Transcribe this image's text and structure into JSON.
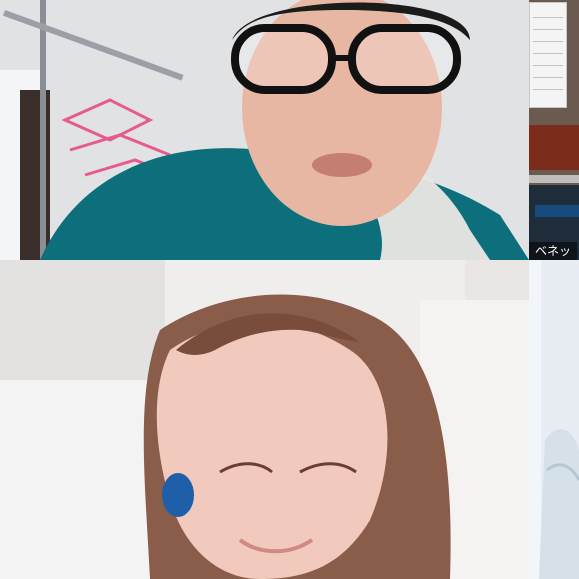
{
  "participants": [
    {
      "name": ""
    },
    {
      "name": "ベネッ"
    },
    {
      "name": ""
    },
    {
      "name": ""
    }
  ]
}
